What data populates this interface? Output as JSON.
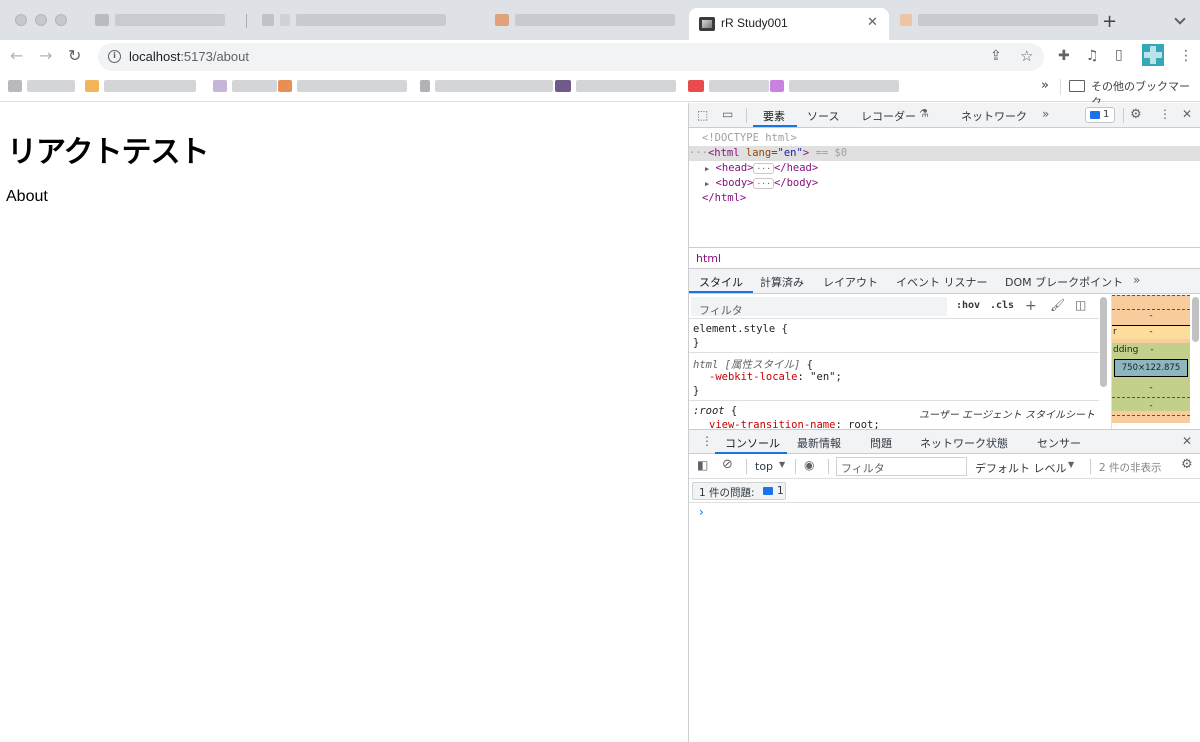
{
  "browser": {
    "active_tab": {
      "title": "rR Study001"
    },
    "new_tab_label": "+",
    "tab_close_label": "✕",
    "url_host": "localhost",
    "url_path": ":5173/about",
    "bookmarks_more_label": "»",
    "bookmarks_other_label": "その他のブックマーク"
  },
  "page": {
    "heading": "リアクトテスト",
    "text": "About"
  },
  "devtools": {
    "main_tabs": [
      "要素",
      "ソース",
      "レコーダー",
      "ネットワーク"
    ],
    "issues_count": "1",
    "dom": {
      "doctype": "<!DOCTYPE html>",
      "html_open_tag": "<html",
      "html_attr_name": "lang",
      "html_attr_value": "\"en\"",
      "html_eq": "== $0",
      "head": "<head>",
      "head_close": "</head>",
      "body": "<body>",
      "body_close": "</body>",
      "html_close": "</html>"
    },
    "breadcrumb": "html",
    "style_tabs": [
      "スタイル",
      "計算済み",
      "レイアウト",
      "イベント リスナー",
      "DOM ブレークポイント"
    ],
    "styles_filter_placeholder": "フィルタ",
    "hov_label": ":hov",
    "cls_label": ".cls",
    "rules": {
      "element_style": "element.style",
      "html_selector": "html",
      "html_note": "[属性スタイル]",
      "html_prop": "-webkit-locale",
      "html_value": "\"en\";",
      "root_selector": ":root",
      "root_origin": "ユーザー エージェント スタイルシート",
      "root_prop": "view-transition-name",
      "root_value": "root;"
    },
    "box_model": {
      "margin": "-",
      "border_label": "r",
      "border": "-",
      "padding_label": "dding",
      "padding": "-",
      "content": "750×122.875",
      "padding_bottom": "-",
      "border_bottom": "-"
    },
    "drawer_tabs": [
      "コンソール",
      "最新情報",
      "問題",
      "ネットワーク状態",
      "センサー"
    ],
    "console": {
      "context": "top",
      "filter_placeholder": "フィルタ",
      "level": "デフォルト レベル",
      "hidden": "2 件の非表示",
      "issues_label": "1 件の問題:",
      "issues_count": "1",
      "prompt": "›"
    }
  }
}
